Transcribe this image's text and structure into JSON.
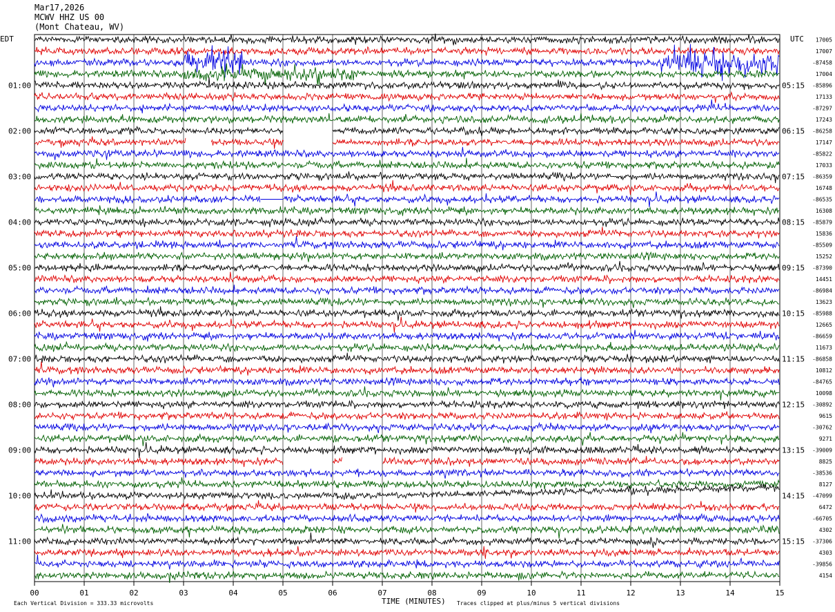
{
  "header": {
    "date": "Mar17,2026",
    "station": "MCWV HHZ US 00",
    "location": "(Mont Chateau, WV)"
  },
  "footer": {
    "scale_note": "Each Vertical Division =  333.33 microvolts",
    "clip_note": "Traces clipped at plus/minus 5 vertical divisions"
  },
  "colors": {
    "trace_cycle": [
      "#000000",
      "#e00000",
      "#0000e0",
      "#006000"
    ],
    "grid": "#000000",
    "background": "#ffffff"
  },
  "chart_data": {
    "type": "line",
    "title": "",
    "xlabel": "TIME (MINUTES)",
    "ylabel": "",
    "left_axis_label": "EDT",
    "right_axis_label": "UTC",
    "xlim": [
      0,
      15
    ],
    "x_ticks": [
      "00",
      "01",
      "02",
      "03",
      "04",
      "05",
      "06",
      "07",
      "08",
      "09",
      "10",
      "11",
      "12",
      "13",
      "14",
      "15"
    ],
    "traces_count": 48,
    "minutes_per_trace": 15,
    "left_hour_labels": [
      {
        "trace": 4,
        "label": "01:00"
      },
      {
        "trace": 8,
        "label": "02:00"
      },
      {
        "trace": 12,
        "label": "03:00"
      },
      {
        "trace": 16,
        "label": "04:00"
      },
      {
        "trace": 20,
        "label": "05:00"
      },
      {
        "trace": 24,
        "label": "06:00"
      },
      {
        "trace": 28,
        "label": "07:00"
      },
      {
        "trace": 32,
        "label": "08:00"
      },
      {
        "trace": 36,
        "label": "09:00"
      },
      {
        "trace": 40,
        "label": "10:00"
      },
      {
        "trace": 44,
        "label": "11:00"
      }
    ],
    "right_hour_labels": [
      {
        "trace": 4,
        "label": "05:15"
      },
      {
        "trace": 8,
        "label": "06:15"
      },
      {
        "trace": 12,
        "label": "07:15"
      },
      {
        "trace": 16,
        "label": "08:15"
      },
      {
        "trace": 20,
        "label": "09:15"
      },
      {
        "trace": 24,
        "label": "10:15"
      },
      {
        "trace": 28,
        "label": "11:15"
      },
      {
        "trace": 32,
        "label": "12:15"
      },
      {
        "trace": 36,
        "label": "13:15"
      },
      {
        "trace": 40,
        "label": "14:15"
      },
      {
        "trace": 44,
        "label": "15:15"
      }
    ],
    "trace_offsets": [
      "17005",
      "17007",
      "-87458",
      "17004",
      "-85896",
      "17133",
      "-87297",
      "17243",
      "-86258",
      "17147",
      "-85822",
      "17033",
      "-86359",
      "16748",
      "-86535",
      "16308",
      "-85879",
      "15836",
      "-85509",
      "15252",
      "-87390",
      "14451",
      "-86984",
      "13623",
      "-85988",
      "12665",
      "-86659",
      "11673",
      "-86858",
      "10812",
      "-84765",
      "10098",
      "-30892",
      "9615",
      "-30762",
      "9271",
      "-39009",
      "8825",
      "-38536",
      "8127",
      "-47099",
      "6472",
      "-66705",
      "4302",
      "-37306",
      "4303",
      "-39856",
      "4154"
    ],
    "gaps": [
      {
        "trace": 9,
        "start_min": 3.05,
        "end_min": 3.55
      },
      {
        "trace": 9,
        "start_min": 5.02,
        "end_min": 6.0
      },
      {
        "trace": 8,
        "start_min": 5.0,
        "end_min": 6.0
      },
      {
        "trace": 37,
        "start_min": 5.0,
        "end_min": 6.0
      },
      {
        "trace": 37,
        "start_min": 6.2,
        "end_min": 7.0
      },
      {
        "trace": 14,
        "start_min": 4.55,
        "end_min": 5.0
      }
    ],
    "clipped_bursts": [
      {
        "trace": 2,
        "start_min": 3.0,
        "end_min": 4.2,
        "amplitude": 5
      },
      {
        "trace": 2,
        "start_min": 12.6,
        "end_min": 15.0,
        "amplitude": 5
      },
      {
        "trace": 3,
        "start_min": 3.0,
        "end_min": 6.5,
        "amplitude": 3
      }
    ],
    "grid": true
  }
}
